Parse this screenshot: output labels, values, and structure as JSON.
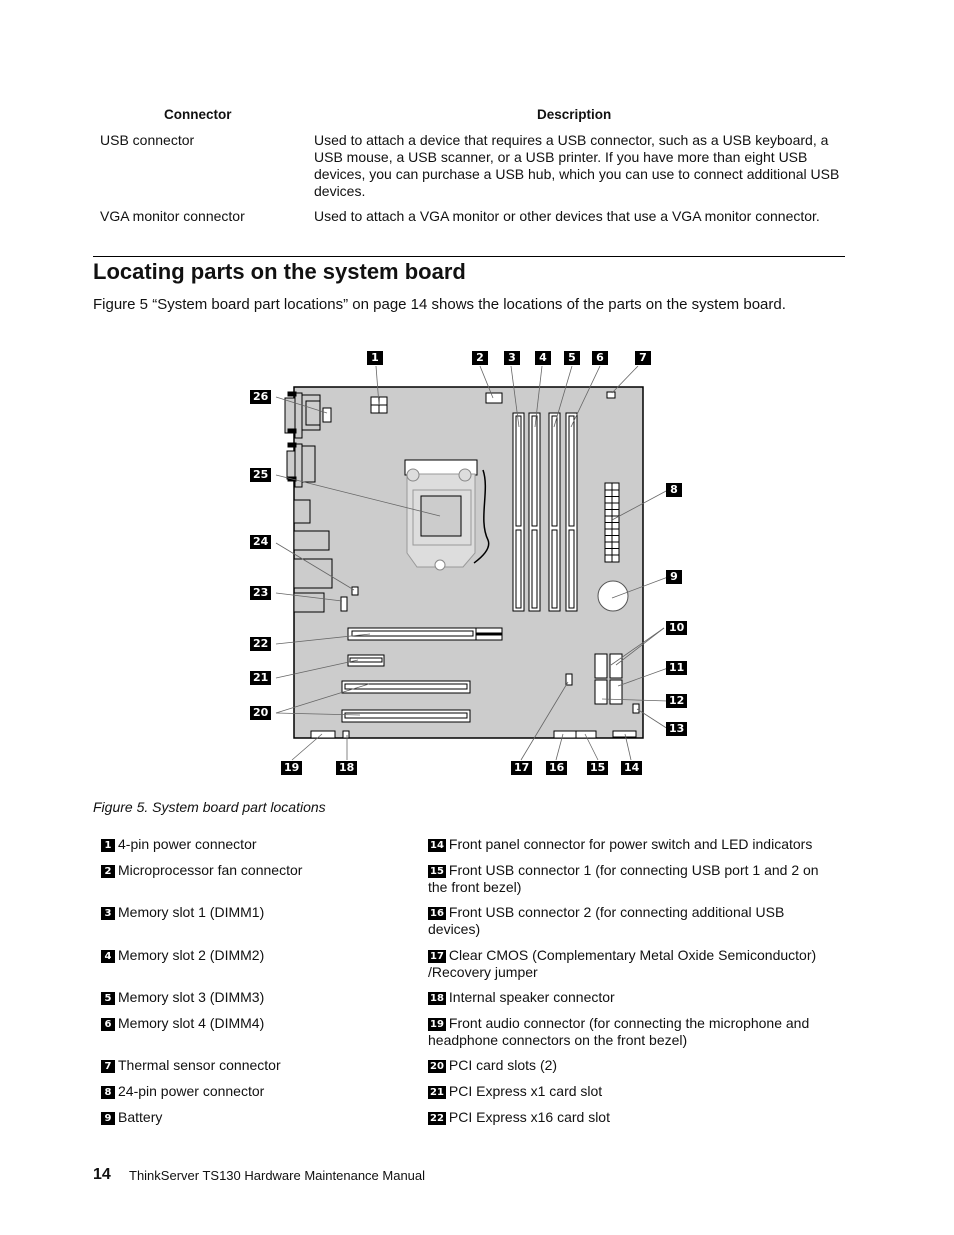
{
  "table": {
    "headers": [
      "Connector",
      "Description"
    ],
    "rows": [
      {
        "connector": "USB connector",
        "description": "Used to attach a device that requires a USB connector, such as a USB keyboard, a USB mouse, a USB scanner, or a USB printer.  If you have more than eight USB devices, you can purchase a USB hub, which you can use to connect additional USB devices."
      },
      {
        "connector": "VGA monitor connector",
        "description": "Used to attach a VGA monitor or other devices that use a VGA monitor connector."
      }
    ]
  },
  "section": {
    "title": "Locating parts on the system board",
    "intro": "Figure 5 “System board part locations” on page 14 shows the locations of the parts on the system board."
  },
  "figure": {
    "caption": "Figure 5.  System board part locations",
    "callouts": [
      "1",
      "2",
      "3",
      "4",
      "5",
      "6",
      "7",
      "8",
      "9",
      "10",
      "11",
      "12",
      "13",
      "14",
      "15",
      "16",
      "17",
      "18",
      "19",
      "20",
      "21",
      "22",
      "23",
      "24",
      "25",
      "26"
    ],
    "board_color": "#cccccc"
  },
  "legend": {
    "left": [
      {
        "num": "1",
        "text": "4-pin power connector"
      },
      {
        "num": "2",
        "text": "Microprocessor fan connector"
      },
      {
        "num": "3",
        "text": "Memory slot 1 (DIMM1)"
      },
      {
        "num": "4",
        "text": "Memory slot 2 (DIMM2)"
      },
      {
        "num": "5",
        "text": "Memory slot 3 (DIMM3)"
      },
      {
        "num": "6",
        "text": "Memory slot 4 (DIMM4)"
      },
      {
        "num": "7",
        "text": "Thermal sensor connector"
      },
      {
        "num": "8",
        "text": "24-pin power connector"
      },
      {
        "num": "9",
        "text": "Battery"
      }
    ],
    "right": [
      {
        "num": "14",
        "text": "Front panel connector for power switch and LED indicators"
      },
      {
        "num": "15",
        "text": "Front USB connector 1 (for connecting USB port 1 and 2 on the front bezel)"
      },
      {
        "num": "16",
        "text": "Front USB connector 2 (for connecting additional USB devices)"
      },
      {
        "num": "17",
        "text": "Clear CMOS (Complementary Metal Oxide Semiconductor) /Recovery jumper"
      },
      {
        "num": "18",
        "text": "Internal speaker connector"
      },
      {
        "num": "19",
        "text": "Front audio connector (for connecting the microphone and headphone connectors on the front bezel)"
      },
      {
        "num": "20",
        "text": "PCI card slots (2)"
      },
      {
        "num": "21",
        "text": "PCI Express x1 card slot"
      },
      {
        "num": "22",
        "text": "PCI Express x16 card slot"
      }
    ]
  },
  "footer": {
    "page_number": "14",
    "title": "ThinkServer TS130 Hardware Maintenance Manual"
  }
}
